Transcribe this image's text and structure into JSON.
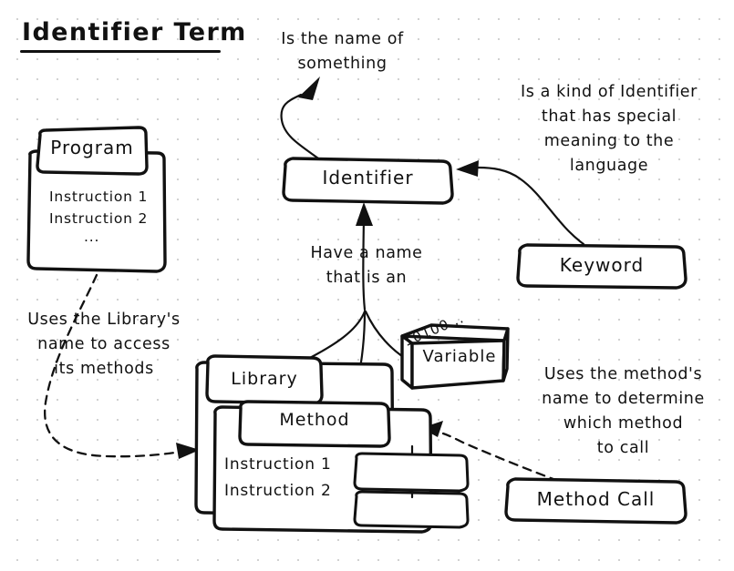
{
  "title": "Identifier Term",
  "notes": {
    "name_of_something": "Is the name of\nsomething",
    "keyword_desc": "Is a kind of Identifier\nthat has special\nmeaning to the\nlanguage",
    "have_a_name": "Have a name\nthat is an",
    "library_usage": "Uses the Library's\nname to access\nits methods",
    "method_usage": "Uses the method's\nname to determine\nwhich method\nto call"
  },
  "nodes": {
    "identifier": {
      "label": "Identifier"
    },
    "keyword": {
      "label": "Keyword"
    },
    "variable": {
      "label": "Variable",
      "binary": "10100..."
    },
    "method_call": {
      "label": "Method Call"
    },
    "program": {
      "label": "Program",
      "lines": [
        "Instruction 1",
        "Instruction 2",
        "..."
      ]
    },
    "library": {
      "label": "Library"
    },
    "method": {
      "label": "Method",
      "lines": [
        "Instruction 1",
        "Instruction 2"
      ]
    }
  },
  "style": {
    "ink": "#111111",
    "paper": "#ffffff",
    "grid_dot": "#c9c9c9"
  }
}
